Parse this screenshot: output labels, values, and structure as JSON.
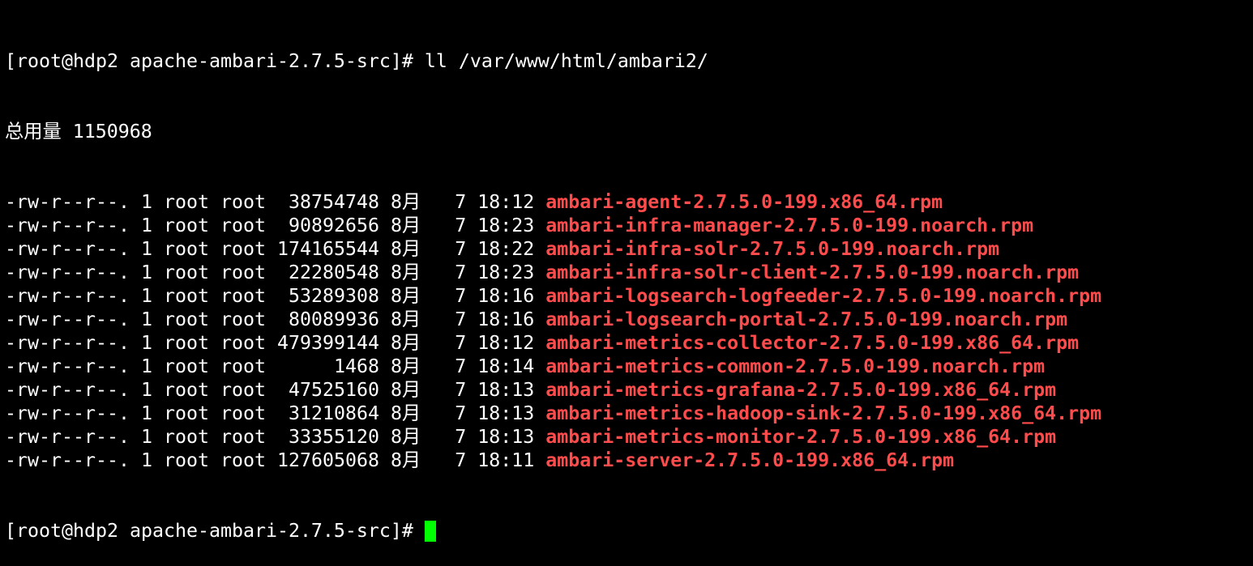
{
  "terminal": {
    "prompt": "[root@hdp2 apache-ambari-2.7.5-src]# ",
    "command": "ll /var/www/html/ambari2/",
    "total_line": "总用量 1150968",
    "filename_color": "#ff4b4b",
    "cursor_color": "#00ff00",
    "files": [
      {
        "perm": "-rw-r--r--.",
        "links": "1",
        "owner": "root",
        "group": "root",
        "size": "38754748",
        "month": "8月",
        "day": "7",
        "time": "18:12",
        "name": "ambari-agent-2.7.5.0-199.x86_64.rpm"
      },
      {
        "perm": "-rw-r--r--.",
        "links": "1",
        "owner": "root",
        "group": "root",
        "size": "90892656",
        "month": "8月",
        "day": "7",
        "time": "18:23",
        "name": "ambari-infra-manager-2.7.5.0-199.noarch.rpm"
      },
      {
        "perm": "-rw-r--r--.",
        "links": "1",
        "owner": "root",
        "group": "root",
        "size": "174165544",
        "month": "8月",
        "day": "7",
        "time": "18:22",
        "name": "ambari-infra-solr-2.7.5.0-199.noarch.rpm"
      },
      {
        "perm": "-rw-r--r--.",
        "links": "1",
        "owner": "root",
        "group": "root",
        "size": "22280548",
        "month": "8月",
        "day": "7",
        "time": "18:23",
        "name": "ambari-infra-solr-client-2.7.5.0-199.noarch.rpm"
      },
      {
        "perm": "-rw-r--r--.",
        "links": "1",
        "owner": "root",
        "group": "root",
        "size": "53289308",
        "month": "8月",
        "day": "7",
        "time": "18:16",
        "name": "ambari-logsearch-logfeeder-2.7.5.0-199.noarch.rpm"
      },
      {
        "perm": "-rw-r--r--.",
        "links": "1",
        "owner": "root",
        "group": "root",
        "size": "80089936",
        "month": "8月",
        "day": "7",
        "time": "18:16",
        "name": "ambari-logsearch-portal-2.7.5.0-199.noarch.rpm"
      },
      {
        "perm": "-rw-r--r--.",
        "links": "1",
        "owner": "root",
        "group": "root",
        "size": "479399144",
        "month": "8月",
        "day": "7",
        "time": "18:12",
        "name": "ambari-metrics-collector-2.7.5.0-199.x86_64.rpm"
      },
      {
        "perm": "-rw-r--r--.",
        "links": "1",
        "owner": "root",
        "group": "root",
        "size": "1468",
        "month": "8月",
        "day": "7",
        "time": "18:14",
        "name": "ambari-metrics-common-2.7.5.0-199.noarch.rpm"
      },
      {
        "perm": "-rw-r--r--.",
        "links": "1",
        "owner": "root",
        "group": "root",
        "size": "47525160",
        "month": "8月",
        "day": "7",
        "time": "18:13",
        "name": "ambari-metrics-grafana-2.7.5.0-199.x86_64.rpm"
      },
      {
        "perm": "-rw-r--r--.",
        "links": "1",
        "owner": "root",
        "group": "root",
        "size": "31210864",
        "month": "8月",
        "day": "7",
        "time": "18:13",
        "name": "ambari-metrics-hadoop-sink-2.7.5.0-199.x86_64.rpm"
      },
      {
        "perm": "-rw-r--r--.",
        "links": "1",
        "owner": "root",
        "group": "root",
        "size": "33355120",
        "month": "8月",
        "day": "7",
        "time": "18:13",
        "name": "ambari-metrics-monitor-2.7.5.0-199.x86_64.rpm"
      },
      {
        "perm": "-rw-r--r--.",
        "links": "1",
        "owner": "root",
        "group": "root",
        "size": "127605068",
        "month": "8月",
        "day": "7",
        "time": "18:11",
        "name": "ambari-server-2.7.5.0-199.x86_64.rpm"
      }
    ]
  }
}
